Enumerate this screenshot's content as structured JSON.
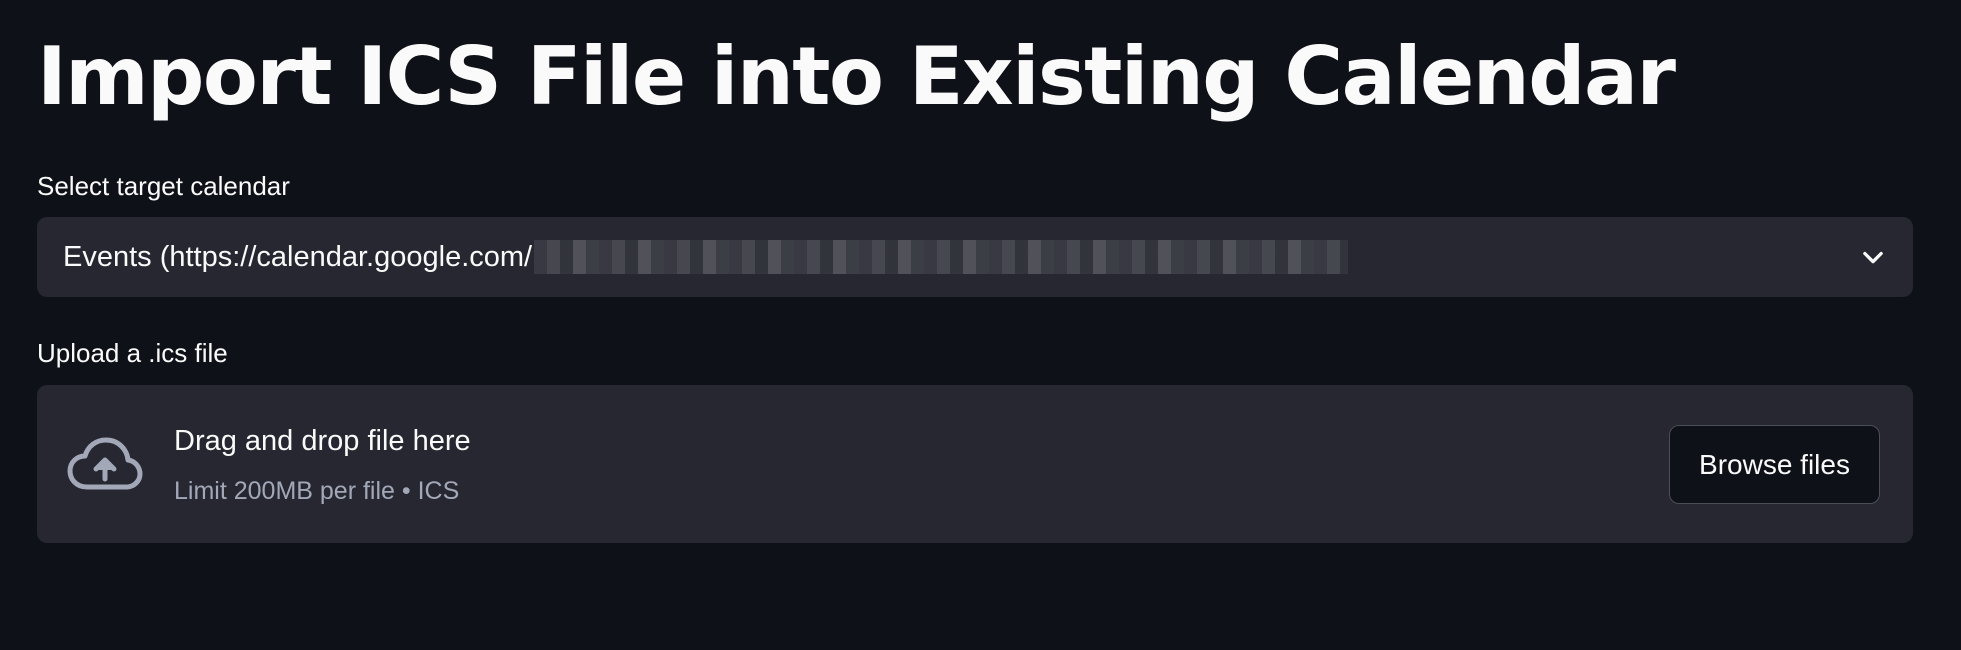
{
  "page": {
    "title": "Import ICS File into Existing Calendar"
  },
  "calendar_select": {
    "label": "Select target calendar",
    "selected_value": "Events (https://calendar.google.com/",
    "icon": "chevron-down-icon"
  },
  "uploader": {
    "label": "Upload a .ics file",
    "drop_text": "Drag and drop file here",
    "limit_text": "Limit 200MB per file • ICS",
    "browse_label": "Browse files",
    "icon": "cloud-upload-icon"
  },
  "colors": {
    "background": "#0e1117",
    "panel": "#262730",
    "text": "#fafafa",
    "muted_text": "#a3a8b8"
  }
}
